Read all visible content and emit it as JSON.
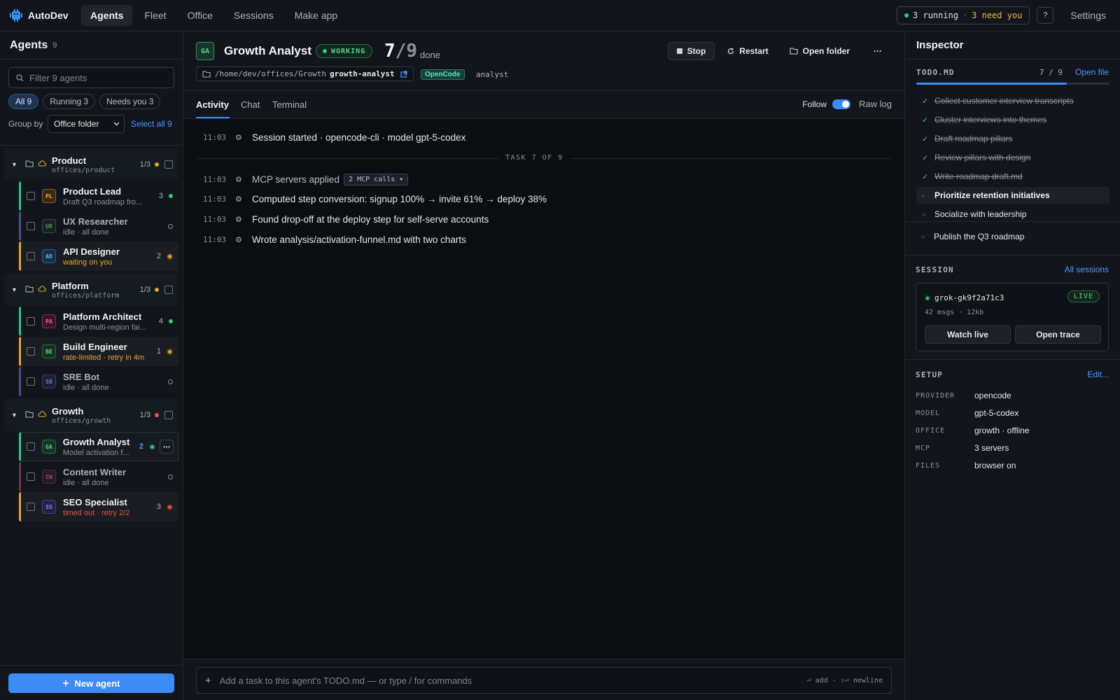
{
  "app": {
    "name": "AutoDev",
    "nav": [
      "Agents",
      "Fleet",
      "Office",
      "Sessions",
      "Make app"
    ],
    "status_running": "3 running",
    "status_sep": "·",
    "status_need": "3 need you",
    "help_glyph": "?",
    "settings": "Settings"
  },
  "colors": {
    "accent": "#3d8bf5",
    "working": "#34c77b",
    "warning": "#e3a33a",
    "error": "#e5534b"
  },
  "sidebar": {
    "title": "Agents",
    "count": "9",
    "filter_placeholder": "Filter 9 agents",
    "chips": [
      "All 9",
      "Running 3",
      "Needs you 3"
    ],
    "group_by_label": "Group by",
    "group_by_value": "Office folder",
    "select_all": "Select all 9",
    "groups": [
      {
        "name": "Product",
        "path": "offices/product",
        "count": "1/3",
        "status": "warning",
        "agents": [
          {
            "initials": "PL",
            "name": "Product Lead",
            "sub": "Draft Q3 roadmap fro...",
            "num": "3",
            "state": "running"
          },
          {
            "initials": "UR",
            "name": "UX Researcher",
            "sub": "idle · all done",
            "num": "",
            "state": "idle"
          },
          {
            "initials": "AD",
            "name": "API Designer",
            "sub": "waiting on you",
            "num": "2",
            "state": "waiting"
          }
        ]
      },
      {
        "name": "Platform",
        "path": "offices/platform",
        "count": "1/3",
        "status": "warning",
        "agents": [
          {
            "initials": "PA",
            "name": "Platform Architect",
            "sub": "Design multi-region fai...",
            "num": "4",
            "state": "running"
          },
          {
            "initials": "BE",
            "name": "Build Engineer",
            "sub": "rate-limited · retry in 4m",
            "num": "1",
            "state": "waiting"
          },
          {
            "initials": "SB",
            "name": "SRE Bot",
            "sub": "idle · all done",
            "num": "",
            "state": "idle"
          }
        ]
      },
      {
        "name": "Growth",
        "path": "offices/growth",
        "count": "1/3",
        "status": "error",
        "agents": [
          {
            "initials": "GA",
            "name": "Growth Analyst",
            "sub": "Model activation f...",
            "num": "2",
            "state": "selected"
          },
          {
            "initials": "CW",
            "name": "Content Writer",
            "sub": "idle · all done",
            "num": "",
            "state": "idle"
          },
          {
            "initials": "SS",
            "name": "SEO Specialist",
            "sub": "timed out · retry 2/2",
            "num": "3",
            "state": "error"
          }
        ]
      }
    ],
    "new_agent": "New agent"
  },
  "main": {
    "avatar": "GA",
    "title": "Growth Analyst",
    "status": "WORKING",
    "progress_done": "7",
    "progress_slash": "/",
    "progress_total": "9",
    "progress_label": "done",
    "actions": {
      "stop": "Stop",
      "restart": "Restart",
      "open_folder": "Open folder",
      "more": "···"
    },
    "path_prefix": "/home/dev/offices/Growth",
    "path_name": "growth-analyst",
    "provider_tag": "OpenCode",
    "role": "analyst",
    "tabs": [
      "Activity",
      "Chat",
      "Terminal"
    ],
    "follow": "Follow",
    "raw_log": "Raw log",
    "task_divider": "TASK 7 OF 9",
    "log": [
      {
        "time": "11:03",
        "text": "Session started · opencode-cli · model gpt-5-codex",
        "pill": ""
      },
      {
        "time": "11:03",
        "text": "MCP servers applied",
        "pill": "2 MCP calls ▾"
      },
      {
        "time": "11:03",
        "text": "Computed step conversion: signup 100% → invite 61% → deploy 38%",
        "pill": ""
      },
      {
        "time": "11:03",
        "text": "Found drop-off at the deploy step for self-serve accounts",
        "pill": ""
      },
      {
        "time": "11:03",
        "text": "Wrote analysis/activation-funnel.md with two charts",
        "pill": ""
      }
    ],
    "composer_placeholder": "Add a task to this agent's TODO.md — or type / for commands",
    "composer_hint": "⏎ add · ⇧⏎ newline"
  },
  "inspector": {
    "title": "Inspector",
    "todo": {
      "label": "TODO.MD",
      "count": "7 / 9",
      "progress": 0.78,
      "open_file": "Open file",
      "items": [
        {
          "text": "Collect customer interview transcripts",
          "state": "done"
        },
        {
          "text": "Cluster interviews into themes",
          "state": "done"
        },
        {
          "text": "Draft roadmap pillars",
          "state": "done"
        },
        {
          "text": "Review pillars with design",
          "state": "done"
        },
        {
          "text": "Write roadmap draft.md",
          "state": "done"
        },
        {
          "text": "Prioritize retention initiatives",
          "state": "current"
        },
        {
          "text": "Socialize with leadership",
          "state": "open"
        },
        {
          "text": "Publish the Q3 roadmap",
          "state": "open"
        }
      ]
    },
    "session": {
      "label": "SESSION",
      "all_sessions": "All sessions",
      "id": "grok-gk9f2a71c3",
      "live": "LIVE",
      "meta": "42 msgs · 12kb",
      "watch_live": "Watch live",
      "open_trace": "Open trace"
    },
    "setup": {
      "label": "SETUP",
      "edit": "Edit...",
      "rows": [
        {
          "key": "PROVIDER",
          "value": "opencode"
        },
        {
          "key": "MODEL",
          "value": "gpt-5-codex"
        },
        {
          "key": "OFFICE",
          "value": "growth · offline"
        },
        {
          "key": "MCP",
          "value": "3 servers"
        },
        {
          "key": "FILES",
          "value": "browser on"
        }
      ]
    }
  }
}
